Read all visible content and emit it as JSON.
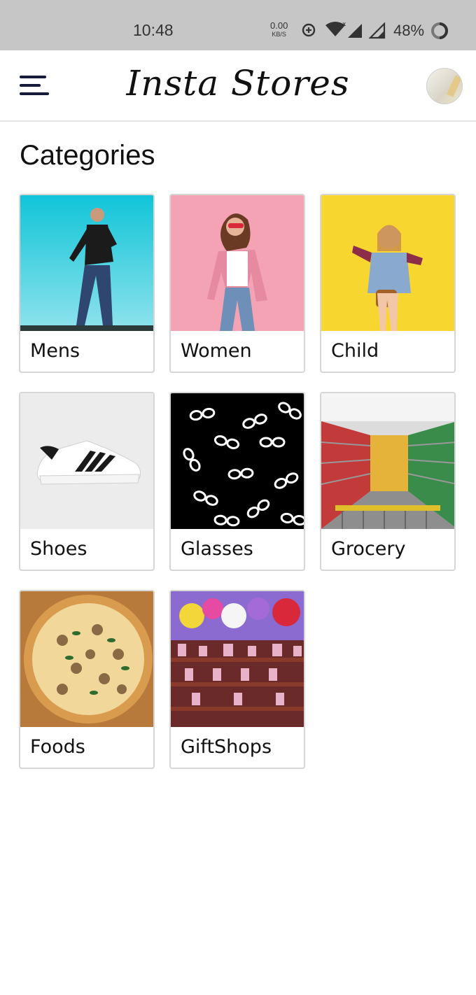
{
  "status_bar": {
    "time": "10:48",
    "net_speed_value": "0.00",
    "net_speed_unit": "KB/S",
    "battery": "48%"
  },
  "app_bar": {
    "title": "Insta Stores"
  },
  "section_title": "Categories",
  "categories": [
    {
      "label": "Mens"
    },
    {
      "label": "Women"
    },
    {
      "label": "Child"
    },
    {
      "label": "Shoes"
    },
    {
      "label": "Glasses"
    },
    {
      "label": "Grocery"
    },
    {
      "label": "Foods"
    },
    {
      "label": "GiftShops"
    }
  ],
  "icons": {
    "menu": "hamburger-menu-icon",
    "avatar": "profile-avatar",
    "wifi": "wifi-icon",
    "signal": "cell-signal-icon",
    "battery": "battery-icon",
    "data_saver": "data-saver-icon"
  },
  "colors": {
    "status_bar_bg": "#c6c6c6",
    "menu_icon": "#151a3a",
    "card_border": "#d6d6d6",
    "mens_bg": "#14c7d6",
    "women_bg": "#f3a3b3",
    "child_bg": "#f7d62f",
    "shoes_bg": "#ececec",
    "glasses_bg": "#000000"
  }
}
